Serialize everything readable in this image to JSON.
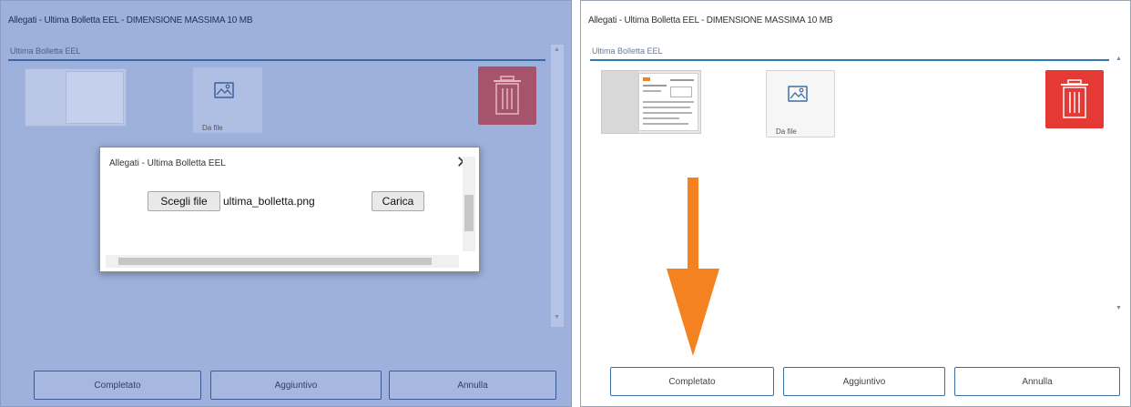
{
  "left": {
    "title": "Allegati - Ultima Bolletta EEL - DIMENSIONE MASSIMA 10 MB",
    "section_label": "Ultima Bolletta EEL",
    "from_file_label": "Da file",
    "buttons": {
      "complete": "Completato",
      "additional": "Aggiuntivo",
      "cancel": "Annulla"
    }
  },
  "dialog": {
    "title": "Allegati - Ultima Bolletta EEL",
    "close_symbol": "✕",
    "choose_file_label": "Scegli file",
    "selected_file": "ultima_bolletta.png",
    "upload_label": "Carica"
  },
  "right": {
    "title": "Allegati - Ultima Bolletta EEL - DIMENSIONE MASSIMA 10 MB",
    "section_label": "Ultima Bolletta EEL",
    "from_file_label": "Da file",
    "buttons": {
      "complete": "Completato",
      "additional": "Aggiuntivo",
      "cancel": "Annulla"
    }
  },
  "colors": {
    "overlay": "#9eb1dd",
    "trash_red": "#e53935",
    "arrow_orange": "#f58220",
    "accent_blue": "#2f7ab3"
  },
  "icons": [
    "image-icon",
    "trash-icon",
    "close-icon",
    "scroll-up-icon",
    "scroll-down-icon",
    "down-arrow-annotation"
  ]
}
